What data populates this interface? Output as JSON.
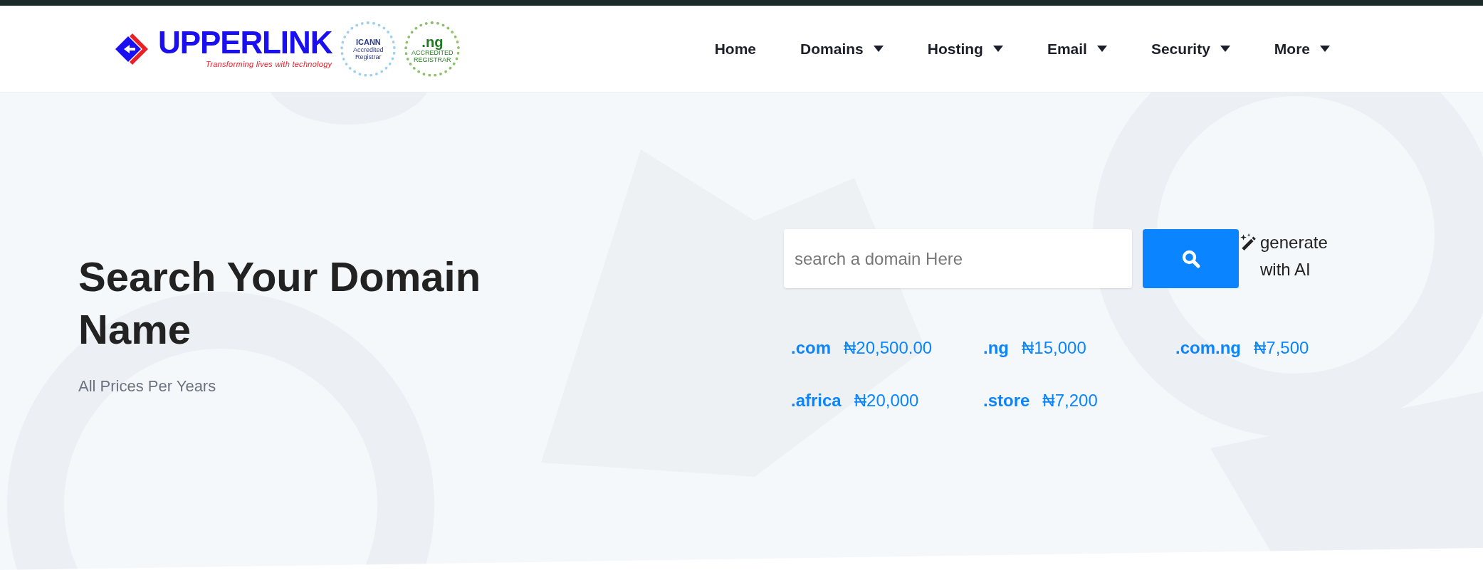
{
  "header": {
    "logo": {
      "name": "UPPERLINK",
      "tagline": "Transforming lives with technology"
    },
    "badges": [
      {
        "kind": "icann",
        "title": "ICANN",
        "caption": "Accredited Registrar"
      },
      {
        "kind": "ng",
        "title": ".ng",
        "caption": "ACCREDITED REGISTRAR"
      }
    ],
    "nav": [
      {
        "label": "Home",
        "dropdown": false
      },
      {
        "label": "Domains",
        "dropdown": true
      },
      {
        "label": "Hosting",
        "dropdown": true
      },
      {
        "label": "Email",
        "dropdown": true
      },
      {
        "label": "Security",
        "dropdown": true
      },
      {
        "label": "More",
        "dropdown": true
      }
    ]
  },
  "hero": {
    "title": "Search Your Domain Name",
    "subtitle": "All Prices Per Years",
    "search": {
      "placeholder": "search a domain Here"
    },
    "ai_link": "generate with AI",
    "prices": [
      {
        "tld": ".com",
        "price": "₦20,500.00"
      },
      {
        "tld": ".ng",
        "price": "₦15,000"
      },
      {
        "tld": ".com.ng",
        "price": "₦7,500"
      },
      {
        "tld": ".africa",
        "price": "₦20,000"
      },
      {
        "tld": ".store",
        "price": "₦7,200"
      }
    ]
  }
}
